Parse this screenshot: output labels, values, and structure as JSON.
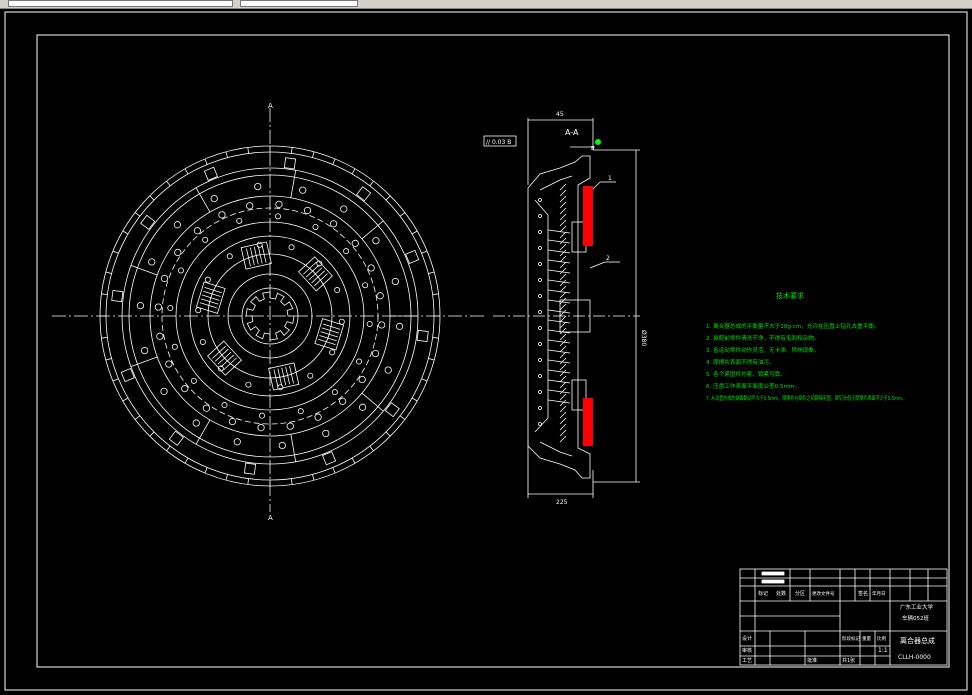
{
  "colors": {
    "background": "#000000",
    "linework": "#ffffff",
    "notes_text": "#00e000",
    "friction_lining": "#ff0000",
    "marker_dot": "#00ff00"
  },
  "section_view": {
    "label": "A-A",
    "dim_width": "45",
    "dim_bottom": "225",
    "dim_diameter": "Ø380",
    "tolerance_frame": "// 0.03 B",
    "callout_1": "1",
    "callout_2": "2",
    "datum": "B"
  },
  "tech_notes": {
    "title": "技术要求",
    "items": [
      "1. 离合器总成的平衡量不大于10g·cm，允许在压盘上钻孔去重平衡。",
      "2. 装配前零件清洗干净，不得有毛刺和杂物。",
      "3. 各运动零件动作灵活，无卡滞、异响现象。",
      "4. 摩擦片表面不得有油污。",
      "5. 各个紧固件拧紧，锁紧可靠。",
      "6. 压盘工作表面平面度公差0.5mm。",
      "7. 从动盘总成的端面跳动不大于0.5mm，摩擦片与钢片之间铆接牢固，铆钉头低于摩擦片表面不少于0.5mm。"
    ]
  },
  "title_block": {
    "drawing_title": "离合器总成",
    "drawing_number": "CLLH-0000",
    "organization": "广东工业大学",
    "class_name": "车辆052班",
    "scale": "1:1",
    "sheet_label": "共1张",
    "header_cells": [
      "标记",
      "处数",
      "分区",
      "更改文件号",
      "签名",
      "年月日"
    ],
    "side_cells": [
      "设计",
      "审核",
      "工艺",
      "批准"
    ],
    "small_labels": [
      "阶段标记",
      "重量",
      "比例"
    ]
  }
}
